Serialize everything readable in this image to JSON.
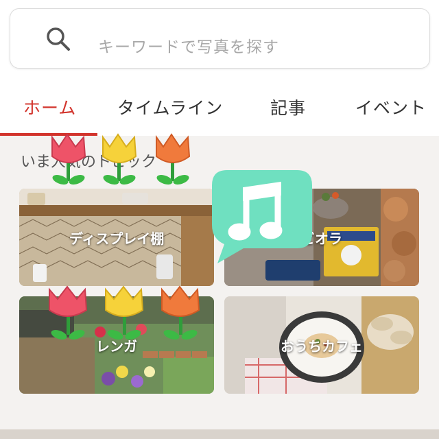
{
  "search": {
    "placeholder": "キーワードで写真を探す"
  },
  "tabs": [
    {
      "label": "ホーム",
      "active": true
    },
    {
      "label": "タイムライン",
      "active": false
    },
    {
      "label": "記事",
      "active": false
    },
    {
      "label": "イベント",
      "active": false
    }
  ],
  "section": {
    "title": "いま人気のトピック"
  },
  "tiles": [
    {
      "label": "ディスプレイ棚"
    },
    {
      "label": "ビオラ"
    },
    {
      "label": "レンガ"
    },
    {
      "label": "おうちカフェ"
    }
  ],
  "colors": {
    "accent": "#d2342c",
    "music_sticker": "#6fe0c0"
  },
  "icons": {
    "search": "search-icon",
    "sticker": "music-note-icon",
    "decor": "tulip-icon"
  }
}
